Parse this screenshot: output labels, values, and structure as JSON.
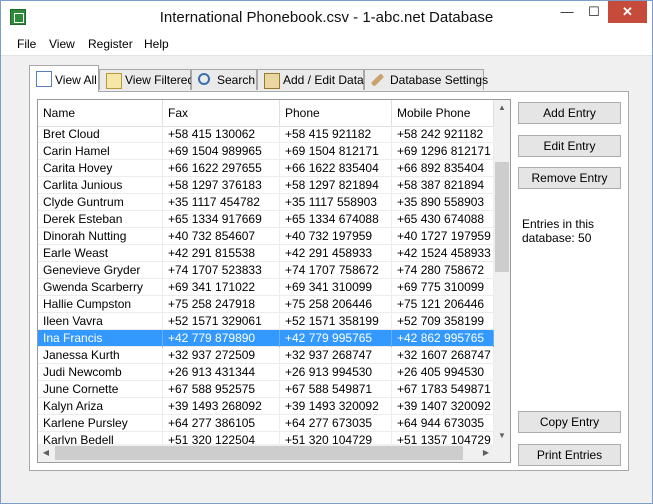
{
  "window": {
    "title": "International Phonebook.csv - 1-abc.net Database",
    "controls": {
      "minimize": "—",
      "maximize": "☐",
      "close": "✕"
    }
  },
  "menu": [
    "File",
    "View",
    "Register",
    "Help"
  ],
  "tabs": [
    {
      "label": "View All",
      "icon": "grid-icon",
      "active": true
    },
    {
      "label": "View Filtered",
      "icon": "filter-icon"
    },
    {
      "label": "Search",
      "icon": "search-icon"
    },
    {
      "label": "Add / Edit Data",
      "icon": "edit-icon"
    },
    {
      "label": "Database Settings",
      "icon": "settings-icon"
    }
  ],
  "table": {
    "columns": [
      "Name",
      "Fax",
      "Phone",
      "Mobile Phone"
    ],
    "selected_index": 12,
    "rows": [
      [
        "Bret Cloud",
        "+58 415 130062",
        "+58 415 921182",
        "+58 242 921182"
      ],
      [
        "Carin Hamel",
        "+69 1504 989965",
        "+69 1504 812171",
        "+69 1296 812171"
      ],
      [
        "Carita Hovey",
        "+66 1622 297655",
        "+66 1622 835404",
        "+66 892 835404"
      ],
      [
        "Carlita Junious",
        "+58 1297 376183",
        "+58 1297 821894",
        "+58 387 821894"
      ],
      [
        "Clyde Guntrum",
        "+35 1117 454782",
        "+35 1117 558903",
        "+35 890 558903"
      ],
      [
        "Derek Esteban",
        "+65 1334 917669",
        "+65 1334 674088",
        "+65 430 674088"
      ],
      [
        "Dinorah Nutting",
        "+40 732 854607",
        "+40 732 197959",
        "+40 1727 197959"
      ],
      [
        "Earle Weast",
        "+42 291 815538",
        "+42 291 458933",
        "+42 1524 458933"
      ],
      [
        "Genevieve Gryder",
        "+74 1707 523833",
        "+74 1707 758672",
        "+74 280 758672"
      ],
      [
        "Gwenda Scarberry",
        "+69 341 171022",
        "+69 341 310099",
        "+69 775 310099"
      ],
      [
        "Hallie Cumpston",
        "+75 258 247918",
        "+75 258 206446",
        "+75 121 206446"
      ],
      [
        "Ileen Vavra",
        "+52 1571 329061",
        "+52 1571 358199",
        "+52 709 358199"
      ],
      [
        "Ina Francis",
        "+42 779 879890",
        "+42 779 995765",
        "+42 862 995765"
      ],
      [
        "Janessa Kurth",
        "+32 937 272509",
        "+32 937 268747",
        "+32 1607 268747"
      ],
      [
        "Judi Newcomb",
        "+26 913 431344",
        "+26 913 994530",
        "+26 405 994530"
      ],
      [
        "June Cornette",
        "+67 588 952575",
        "+67 588 549871",
        "+67 1783 549871"
      ],
      [
        "Kalyn Ariza",
        "+39 1493 268092",
        "+39 1493 320092",
        "+39 1407 320092"
      ],
      [
        "Karlene Pursley",
        "+64 277 386105",
        "+64 277 673035",
        "+64 944 673035"
      ],
      [
        "Karlyn Bedell",
        "+51 320 122504",
        "+51 320 104729",
        "+51 1357 104729"
      ]
    ]
  },
  "buttons": {
    "add": "Add Entry",
    "edit": "Edit Entry",
    "remove": "Remove Entry",
    "copy": "Copy Entry",
    "print": "Print Entries"
  },
  "info": "Entries in this database: 50",
  "scroll": {
    "up": "▲",
    "down": "▼",
    "left": "◀",
    "right": "▶"
  },
  "colors": {
    "selection": "#3399ff",
    "close_button": "#c74b3b"
  }
}
